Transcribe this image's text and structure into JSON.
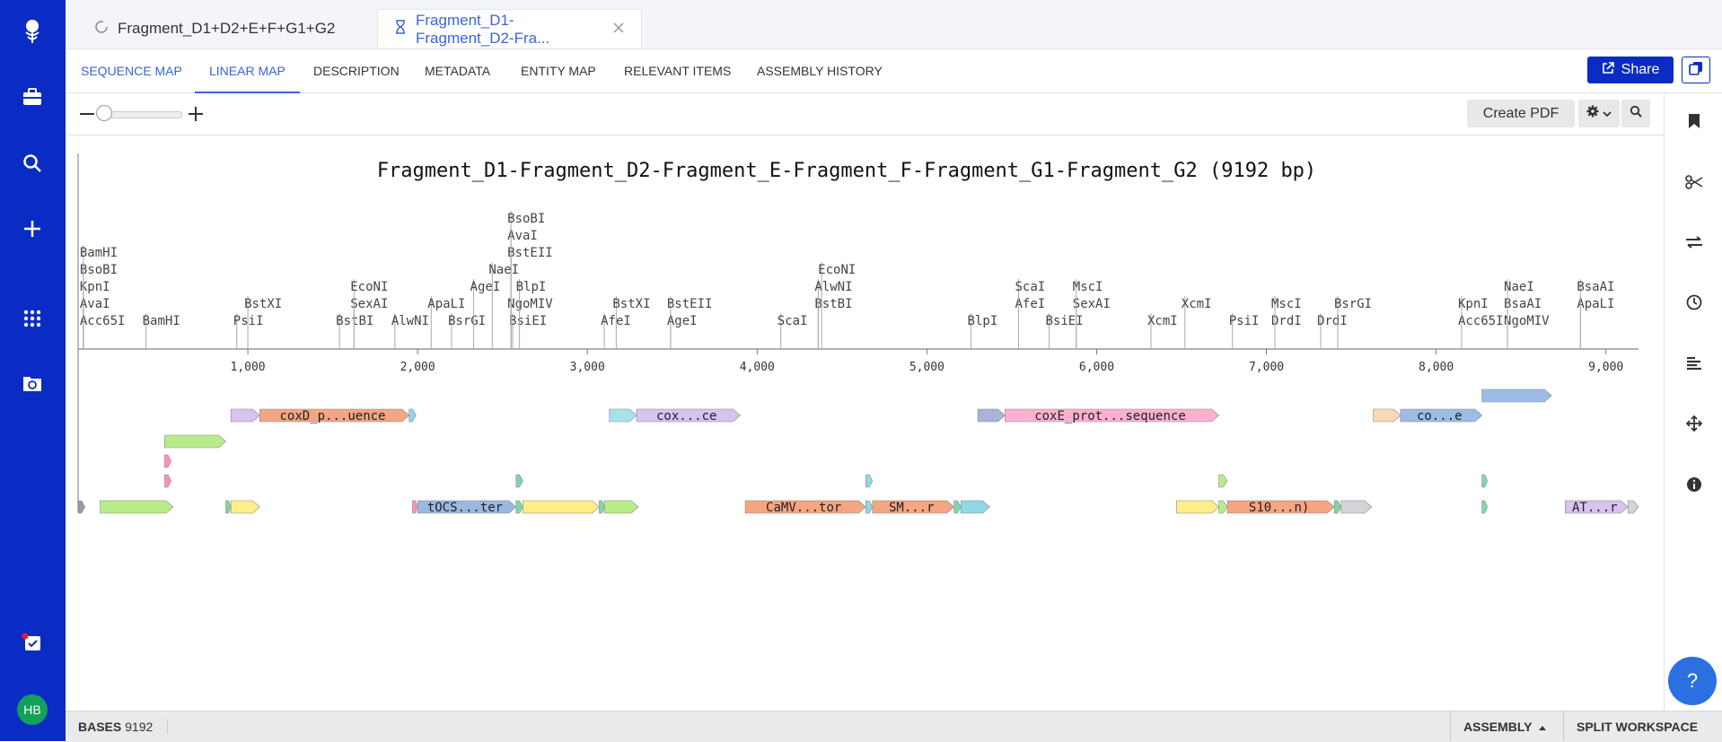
{
  "tabs": [
    {
      "label": "Fragment_D1+D2+E+F+G1+G2",
      "icon": "circle-arrow-icon"
    },
    {
      "label": "Fragment_D1-Fragment_D2-Fra...",
      "icon": "hourglass-icon"
    }
  ],
  "nav_tabs": [
    "SEQUENCE MAP",
    "LINEAR MAP",
    "DESCRIPTION",
    "METADATA",
    "ENTITY MAP",
    "RELEVANT ITEMS",
    "ASSEMBLY HISTORY"
  ],
  "active_nav": "LINEAR MAP",
  "share_label": "Share",
  "create_pdf_label": "Create PDF",
  "map_title": "Fragment_D1-Fragment_D2-Fragment_E-Fragment_F-Fragment_G1-Fragment_G2 (9192 bp)",
  "sequence_length": 9192,
  "axis_ticks": [
    "1,000",
    "2,000",
    "3,000",
    "4,000",
    "5,000",
    "6,000",
    "7,000",
    "8,000",
    "9,000"
  ],
  "enzymes": [
    {
      "name": "Acc65I",
      "pos": 31,
      "level": 0
    },
    {
      "name": "AvaI",
      "pos": 31,
      "level": 1
    },
    {
      "name": "KpnI",
      "pos": 31,
      "level": 2
    },
    {
      "name": "BsoBI",
      "pos": 31,
      "level": 3
    },
    {
      "name": "BamHI",
      "pos": 31,
      "level": 4
    },
    {
      "name": "BamHI",
      "pos": 400,
      "level": 0
    },
    {
      "name": "PsiI",
      "pos": 935,
      "level": 0
    },
    {
      "name": "BstXI",
      "pos": 1000,
      "level": 1
    },
    {
      "name": "BstBI",
      "pos": 1540,
      "level": 0
    },
    {
      "name": "SexAI",
      "pos": 1625,
      "level": 1
    },
    {
      "name": "EcoNI",
      "pos": 1625,
      "level": 2
    },
    {
      "name": "AlwNI",
      "pos": 1866,
      "level": 0
    },
    {
      "name": "BsrGI",
      "pos": 2200,
      "level": 0
    },
    {
      "name": "ApaLI",
      "pos": 2080,
      "level": 1
    },
    {
      "name": "AgeI",
      "pos": 2330,
      "level": 2
    },
    {
      "name": "NaeI",
      "pos": 2440,
      "level": 3
    },
    {
      "name": "BsiEI",
      "pos": 2560,
      "level": 0
    },
    {
      "name": "NgoMIV",
      "pos": 2550,
      "level": 1
    },
    {
      "name": "BstEII",
      "pos": 2550,
      "level": 4
    },
    {
      "name": "AvaI",
      "pos": 2550,
      "level": 5
    },
    {
      "name": "BsoBI",
      "pos": 2550,
      "level": 6
    },
    {
      "name": "BlpI",
      "pos": 2600,
      "level": 2
    },
    {
      "name": "AfeI",
      "pos": 3100,
      "level": 0
    },
    {
      "name": "BstXI",
      "pos": 3170,
      "level": 1
    },
    {
      "name": "AgeI",
      "pos": 3490,
      "level": 0
    },
    {
      "name": "BstEII",
      "pos": 3490,
      "level": 1
    },
    {
      "name": "ScaI",
      "pos": 4140,
      "level": 0
    },
    {
      "name": "BstBI",
      "pos": 4360,
      "level": 1
    },
    {
      "name": "AlwNI",
      "pos": 4360,
      "level": 2
    },
    {
      "name": "EcoNI",
      "pos": 4380,
      "level": 3
    },
    {
      "name": "BlpI",
      "pos": 5260,
      "level": 0
    },
    {
      "name": "AfeI",
      "pos": 5540,
      "level": 1
    },
    {
      "name": "ScaI",
      "pos": 5540,
      "level": 2
    },
    {
      "name": "BsiEI",
      "pos": 5720,
      "level": 0
    },
    {
      "name": "SexAI",
      "pos": 5880,
      "level": 1
    },
    {
      "name": "MscI",
      "pos": 5880,
      "level": 2
    },
    {
      "name": "XcmI",
      "pos": 6320,
      "level": 0
    },
    {
      "name": "XcmI",
      "pos": 6520,
      "level": 1
    },
    {
      "name": "PsiI",
      "pos": 6800,
      "level": 0
    },
    {
      "name": "DrdI",
      "pos": 7050,
      "level": 0
    },
    {
      "name": "MscI",
      "pos": 7050,
      "level": 1
    },
    {
      "name": "DrdI",
      "pos": 7320,
      "level": 0
    },
    {
      "name": "BsrGI",
      "pos": 7420,
      "level": 1
    },
    {
      "name": "Acc65I",
      "pos": 8150,
      "level": 0
    },
    {
      "name": "KpnI",
      "pos": 8150,
      "level": 1
    },
    {
      "name": "NgoMIV",
      "pos": 8420,
      "level": 0
    },
    {
      "name": "BsaAI",
      "pos": 8420,
      "level": 1
    },
    {
      "name": "NaeI",
      "pos": 8420,
      "level": 2
    },
    {
      "name": "ApaLI",
      "pos": 8850,
      "level": 1
    },
    {
      "name": "BsaAI",
      "pos": 8850,
      "level": 2
    }
  ],
  "features": [
    {
      "label": "",
      "start": 1,
      "end": 40,
      "row": 5,
      "color": "#9a9a9a"
    },
    {
      "label": "",
      "start": 130,
      "end": 560,
      "row": 5,
      "color": "#b8ec8a"
    },
    {
      "label": "",
      "start": 870,
      "end": 900,
      "row": 5,
      "color": "#7fd6a8"
    },
    {
      "label": "",
      "start": 900,
      "end": 1070,
      "row": 5,
      "color": "#ffee8a"
    },
    {
      "label": "",
      "start": 1970,
      "end": 2000,
      "row": 5,
      "color": "#ff8fbf"
    },
    {
      "label": "tOCS...ter",
      "start": 2000,
      "end": 2580,
      "row": 5,
      "color": "#9bb9e0"
    },
    {
      "label": "",
      "start": 2580,
      "end": 2620,
      "row": 5,
      "color": "#7fd6a8"
    },
    {
      "label": "",
      "start": 2620,
      "end": 3070,
      "row": 5,
      "color": "#ffee8a"
    },
    {
      "label": "",
      "start": 3070,
      "end": 3100,
      "row": 5,
      "color": "#7fd6a8"
    },
    {
      "label": "",
      "start": 3100,
      "end": 3300,
      "row": 5,
      "color": "#b8ec8a"
    },
    {
      "label": "CaMV...tor",
      "start": 3930,
      "end": 4640,
      "row": 5,
      "color": "#f4a582"
    },
    {
      "label": "",
      "start": 4640,
      "end": 4680,
      "row": 5,
      "color": "#8fd8e4"
    },
    {
      "label": "SM...r",
      "start": 4680,
      "end": 5160,
      "row": 5,
      "color": "#f4a582"
    },
    {
      "label": "",
      "start": 5160,
      "end": 5200,
      "row": 5,
      "color": "#7fd6a8"
    },
    {
      "label": "",
      "start": 5200,
      "end": 5370,
      "row": 5,
      "color": "#8fd8e4"
    },
    {
      "label": "",
      "start": 6470,
      "end": 6720,
      "row": 5,
      "color": "#ffee8a"
    },
    {
      "label": "",
      "start": 6720,
      "end": 6770,
      "row": 5,
      "color": "#b8ec8a"
    },
    {
      "label": "S10...n)",
      "start": 6770,
      "end": 7400,
      "row": 5,
      "color": "#f4a582"
    },
    {
      "label": "",
      "start": 7400,
      "end": 7440,
      "row": 5,
      "color": "#7fd6a8"
    },
    {
      "label": "",
      "start": 7440,
      "end": 7620,
      "row": 5,
      "color": "#d3d3d8"
    },
    {
      "label": "",
      "start": 8270,
      "end": 8300,
      "row": 5,
      "color": "#7fd6a8"
    },
    {
      "label": "AT...r",
      "start": 8760,
      "end": 9130,
      "row": 5,
      "color": "#d8c2ef"
    },
    {
      "label": "",
      "start": 9130,
      "end": 9192,
      "row": 5,
      "color": "#d3d3d8"
    },
    {
      "label": "",
      "start": 510,
      "end": 548,
      "row": 4,
      "color": "#ff8fbf"
    },
    {
      "label": "",
      "start": 2580,
      "end": 2620,
      "row": 4,
      "color": "#7fd6a8"
    },
    {
      "label": "",
      "start": 4640,
      "end": 4680,
      "row": 4,
      "color": "#8fd8e4"
    },
    {
      "label": "",
      "start": 6720,
      "end": 6770,
      "row": 4,
      "color": "#b8ec8a"
    },
    {
      "label": "",
      "start": 8270,
      "end": 8300,
      "row": 4,
      "color": "#7fd6a8"
    },
    {
      "label": "",
      "start": 510,
      "end": 548,
      "row": 3,
      "color": "#ff8fbf"
    },
    {
      "label": "",
      "start": 510,
      "end": 870,
      "row": 2,
      "color": "#b8ec8a"
    },
    {
      "label": "",
      "start": 900,
      "end": 1070,
      "row": 1,
      "color": "#d8c2ef"
    },
    {
      "label": "coxD_p...uence",
      "start": 1070,
      "end": 1950,
      "row": 1,
      "color": "#f4a582"
    },
    {
      "label": "",
      "start": 1950,
      "end": 1990,
      "row": 1,
      "color": "#8fd8e4"
    },
    {
      "label": "",
      "start": 3130,
      "end": 3290,
      "row": 1,
      "color": "#a6e2ee"
    },
    {
      "label": "cox...ce",
      "start": 3290,
      "end": 3900,
      "row": 1,
      "color": "#d8c2ef"
    },
    {
      "label": "",
      "start": 5300,
      "end": 5460,
      "row": 1,
      "color": "#aab4d6"
    },
    {
      "label": "coxE_prot...sequence",
      "start": 5460,
      "end": 6720,
      "row": 1,
      "color": "#ffb0d0"
    },
    {
      "label": "",
      "start": 7630,
      "end": 7790,
      "row": 1,
      "color": "#f9d9b6"
    },
    {
      "label": "co...e",
      "start": 7790,
      "end": 8270,
      "row": 1,
      "color": "#9bbde6"
    },
    {
      "label": "",
      "start": 8270,
      "end": 8680,
      "row": 0,
      "color": "#9bbde6"
    }
  ],
  "status": {
    "bases_label": "BASES",
    "bases_value": "9192",
    "assembly_label": "ASSEMBLY",
    "split_label": "SPLIT WORKSPACE"
  },
  "help_label": "?",
  "avatar_initials": "HB",
  "colors": {
    "rail": "#0a2cc4",
    "accent": "#3c64d8"
  }
}
